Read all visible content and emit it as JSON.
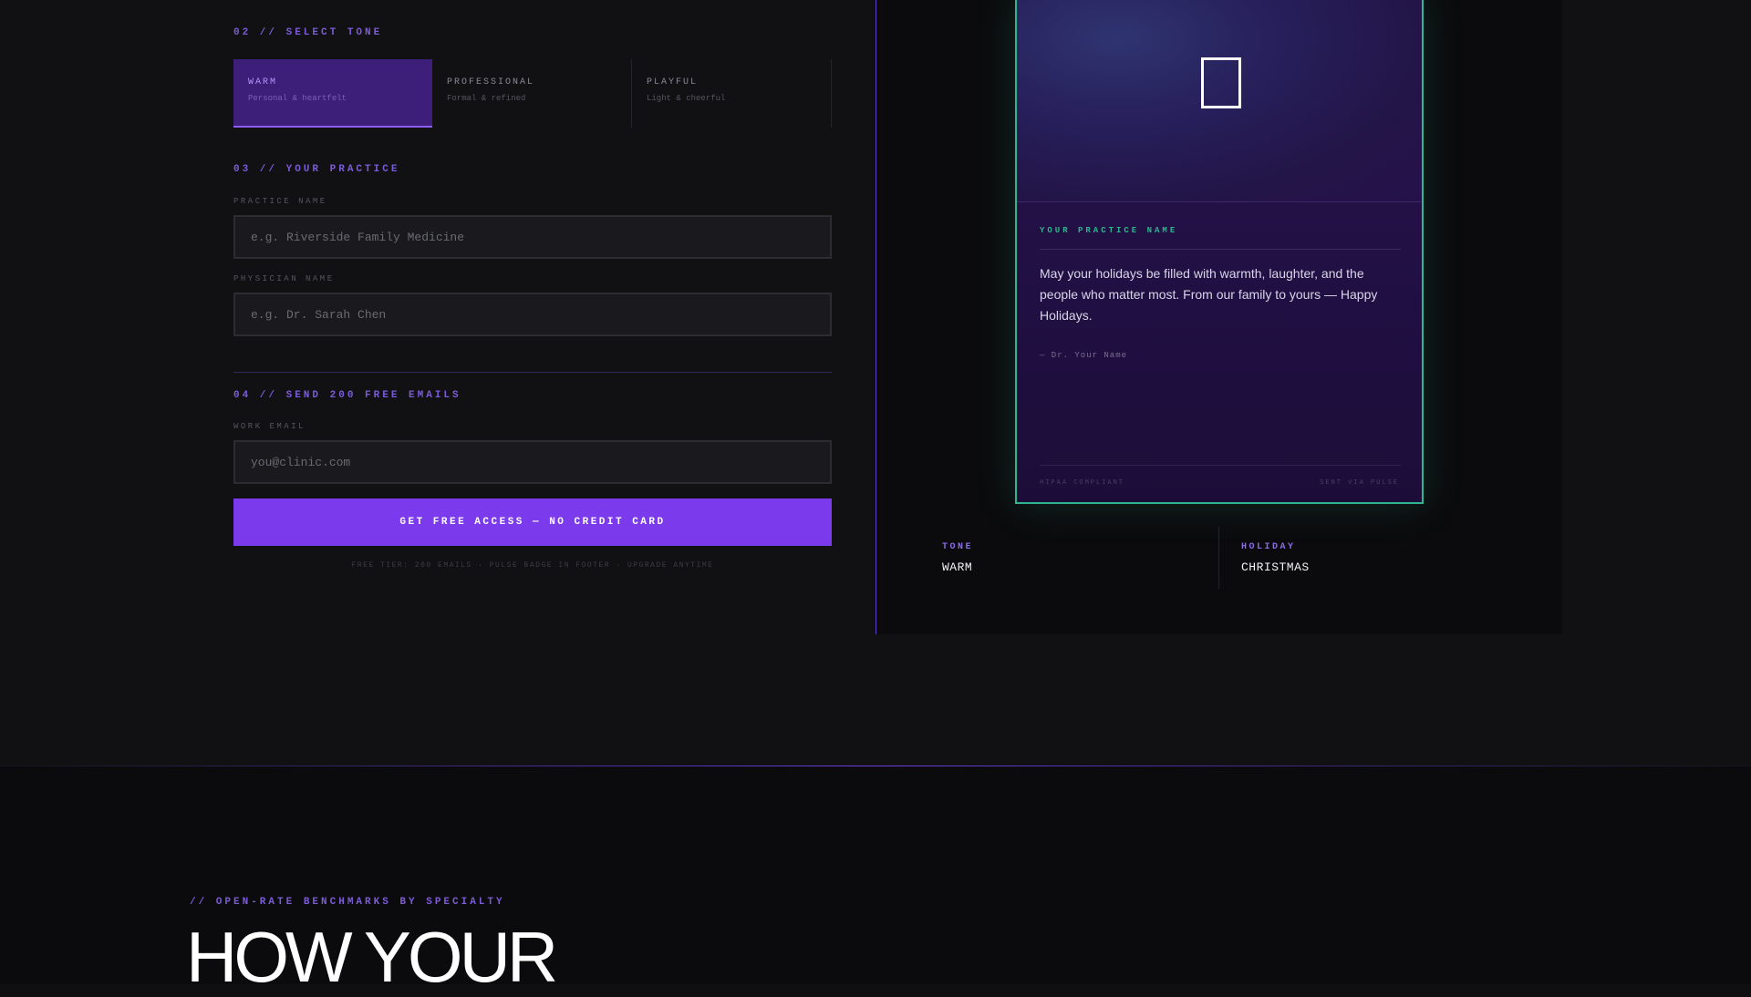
{
  "tone_section": {
    "heading": "02 // SELECT TONE",
    "options": [
      {
        "title": "WARM",
        "subtitle": "Personal & heartfelt",
        "selected": true
      },
      {
        "title": "PROFESSIONAL",
        "subtitle": "Formal & refined",
        "selected": false
      },
      {
        "title": "PLAYFUL",
        "subtitle": "Light & cheerful",
        "selected": false
      }
    ]
  },
  "practice_section": {
    "heading": "03 // YOUR PRACTICE",
    "practice_label": "PRACTICE NAME",
    "practice_placeholder": "e.g. Riverside Family Medicine",
    "physician_label": "PHYSICIAN NAME",
    "physician_placeholder": "e.g. Dr. Sarah Chen"
  },
  "email_section": {
    "heading": "04 // SEND 200 FREE EMAILS",
    "email_label": "WORK EMAIL",
    "email_placeholder": "you@clinic.com",
    "cta_label": "GET FREE ACCESS — NO CREDIT CARD",
    "fine_print": "FREE TIER: 200 EMAILS · PULSE BADGE IN FOOTER · UPGRADE ANYTIME"
  },
  "preview": {
    "practice_name": "YOUR PRACTICE NAME",
    "message": "May your holidays be filled with warmth, laughter, and the people who matter most. From our family to yours — Happy Holidays.",
    "signature": "— Dr. Your Name",
    "footer_left": "HIPAA COMPLIANT",
    "footer_right": "SENT VIA PULSE",
    "tone_label": "TONE",
    "tone_value": "WARM",
    "holiday_label": "HOLIDAY",
    "holiday_value": "CHRISTMAS"
  },
  "benchmarks": {
    "eyebrow": "// OPEN-RATE BENCHMARKS BY SPECIALTY",
    "title": "HOW YOUR"
  },
  "colors": {
    "accent": "#7c3aed",
    "teal": "#2fb58f",
    "background": "#111114"
  }
}
